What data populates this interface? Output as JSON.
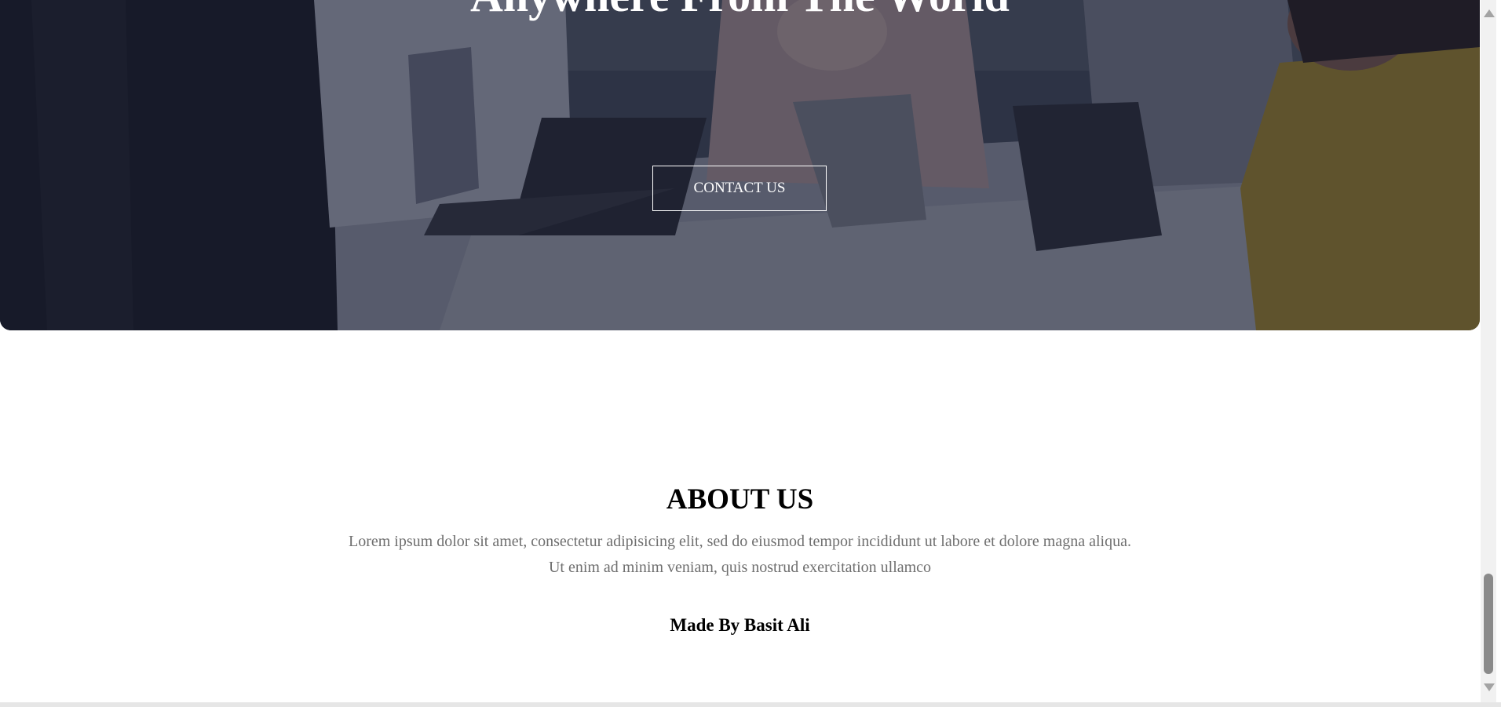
{
  "hero": {
    "title": "Anywhere From The World",
    "contact_button": "CONTACT US"
  },
  "about": {
    "title": "ABOUT US",
    "line1": "Lorem ipsum dolor sit amet, consectetur adipisicing elit, sed do eiusmod tempor incididunt ut labore et dolore magna aliqua.",
    "line2": "Ut enim ad minim veniam, quis nostrud exercitation ullamco"
  },
  "footer": {
    "credit": "Made By Basit Ali"
  },
  "colors": {
    "overlay": "#161a30",
    "body_text": "#6f6f6f",
    "heading": "#000000"
  }
}
